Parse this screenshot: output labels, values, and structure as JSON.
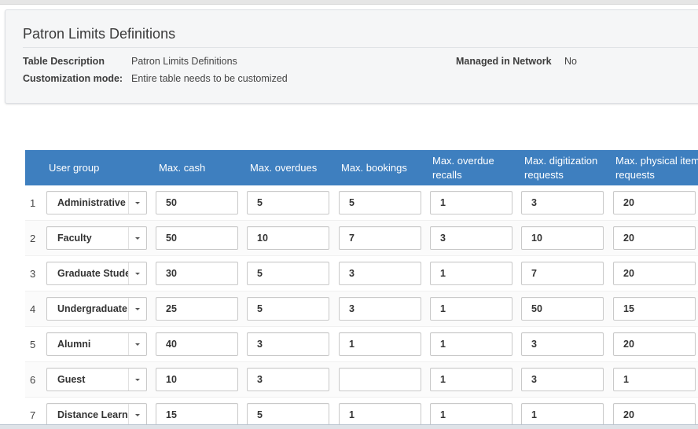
{
  "panel": {
    "title": "Patron Limits Definitions",
    "table_description_label": "Table Description",
    "table_description_value": "Patron Limits Definitions",
    "customization_label": "Customization mode:",
    "customization_value": "Entire table needs to be customized",
    "managed_label": "Managed in Network",
    "managed_value": "No"
  },
  "grid": {
    "headers": [
      "User group",
      "Max. cash",
      "Max. overdues",
      "Max. bookings",
      "Max. overdue recalls",
      "Max. digitization requests",
      "Max. physical item requests"
    ],
    "rows": [
      {
        "num": "1",
        "group": "Administrative",
        "cash": "50",
        "overdues": "5",
        "bookings": "5",
        "recalls": "1",
        "digitization": "3",
        "physical": "20"
      },
      {
        "num": "2",
        "group": "Faculty",
        "cash": "50",
        "overdues": "10",
        "bookings": "7",
        "recalls": "3",
        "digitization": "10",
        "physical": "20"
      },
      {
        "num": "3",
        "group": "Graduate Student",
        "cash": "30",
        "overdues": "5",
        "bookings": "3",
        "recalls": "1",
        "digitization": "7",
        "physical": "20"
      },
      {
        "num": "4",
        "group": "Undergraduate",
        "cash": "25",
        "overdues": "5",
        "bookings": "3",
        "recalls": "1",
        "digitization": "50",
        "physical": "15"
      },
      {
        "num": "5",
        "group": "Alumni",
        "cash": "40",
        "overdues": "3",
        "bookings": "1",
        "recalls": "1",
        "digitization": "3",
        "physical": "20"
      },
      {
        "num": "6",
        "group": "Guest",
        "cash": "10",
        "overdues": "3",
        "bookings": "",
        "recalls": "1",
        "digitization": "3",
        "physical": "1"
      },
      {
        "num": "7",
        "group": "Distance Learner",
        "cash": "15",
        "overdues": "5",
        "bookings": "1",
        "recalls": "1",
        "digitization": "1",
        "physical": "20"
      }
    ]
  },
  "colors": {
    "header_bg": "#3e7fbf",
    "header_text": "#ffffff"
  }
}
